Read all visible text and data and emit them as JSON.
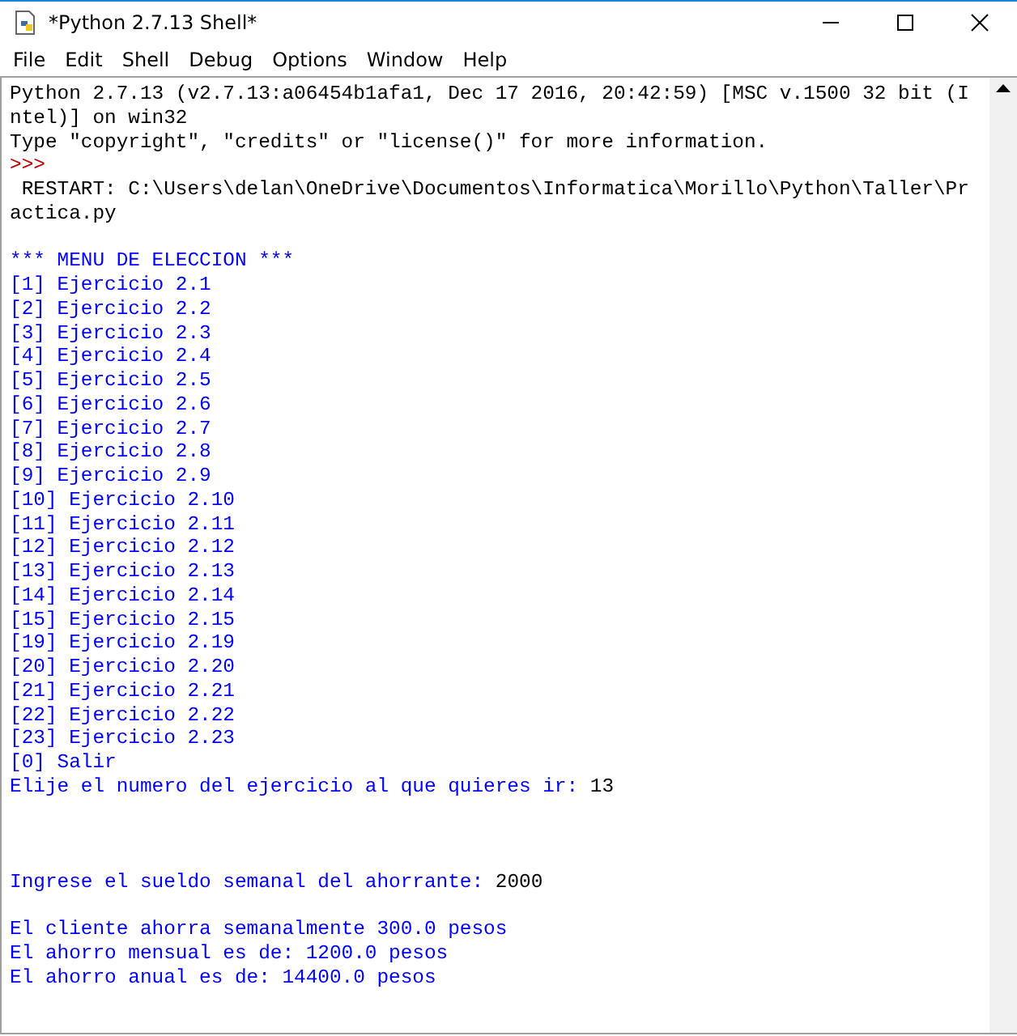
{
  "window": {
    "title": "*Python 2.7.13 Shell*"
  },
  "menu": [
    "File",
    "Edit",
    "Shell",
    "Debug",
    "Options",
    "Window",
    "Help"
  ],
  "shell": {
    "lines": [
      {
        "kind": "text",
        "segments": [
          {
            "kind": "output",
            "text": "Python 2.7.13 (v2.7.13:a06454b1afa1, Dec 17 2016, 20:42:59) [MSC v.1500 32 bit (I"
          }
        ]
      },
      {
        "kind": "text",
        "segments": [
          {
            "kind": "output",
            "text": "ntel)] on win32"
          }
        ]
      },
      {
        "kind": "text",
        "segments": [
          {
            "kind": "output",
            "text": "Type \"copyright\", \"credits\" or \"license()\" for more information."
          }
        ]
      },
      {
        "kind": "text",
        "segments": [
          {
            "kind": "prompt",
            "text": ">>>"
          }
        ]
      },
      {
        "kind": "text",
        "segments": [
          {
            "kind": "output",
            "text": " RESTART: C:\\Users\\delan\\OneDrive\\Documentos\\Informatica\\Morillo\\Python\\Taller\\Pr"
          }
        ]
      },
      {
        "kind": "text",
        "segments": [
          {
            "kind": "output",
            "text": "actica.py"
          }
        ]
      },
      {
        "kind": "blank"
      },
      {
        "kind": "text",
        "segments": [
          {
            "kind": "stdout",
            "text": "*** MENU DE ELECCION ***"
          }
        ]
      },
      {
        "kind": "text",
        "segments": [
          {
            "kind": "stdout",
            "text": "[1] Ejercicio 2.1"
          }
        ]
      },
      {
        "kind": "text",
        "segments": [
          {
            "kind": "stdout",
            "text": "[2] Ejercicio 2.2"
          }
        ]
      },
      {
        "kind": "text",
        "segments": [
          {
            "kind": "stdout",
            "text": "[3] Ejercicio 2.3"
          }
        ]
      },
      {
        "kind": "text",
        "segments": [
          {
            "kind": "stdout",
            "text": "[4] Ejercicio 2.4"
          }
        ]
      },
      {
        "kind": "text",
        "segments": [
          {
            "kind": "stdout",
            "text": "[5] Ejercicio 2.5"
          }
        ]
      },
      {
        "kind": "text",
        "segments": [
          {
            "kind": "stdout",
            "text": "[6] Ejercicio 2.6"
          }
        ]
      },
      {
        "kind": "text",
        "segments": [
          {
            "kind": "stdout",
            "text": "[7] Ejercicio 2.7"
          }
        ]
      },
      {
        "kind": "text",
        "segments": [
          {
            "kind": "stdout",
            "text": "[8] Ejercicio 2.8"
          }
        ]
      },
      {
        "kind": "text",
        "segments": [
          {
            "kind": "stdout",
            "text": "[9] Ejercicio 2.9"
          }
        ]
      },
      {
        "kind": "text",
        "segments": [
          {
            "kind": "stdout",
            "text": "[10] Ejercicio 2.10"
          }
        ]
      },
      {
        "kind": "text",
        "segments": [
          {
            "kind": "stdout",
            "text": "[11] Ejercicio 2.11"
          }
        ]
      },
      {
        "kind": "text",
        "segments": [
          {
            "kind": "stdout",
            "text": "[12] Ejercicio 2.12"
          }
        ]
      },
      {
        "kind": "text",
        "segments": [
          {
            "kind": "stdout",
            "text": "[13] Ejercicio 2.13"
          }
        ]
      },
      {
        "kind": "text",
        "segments": [
          {
            "kind": "stdout",
            "text": "[14] Ejercicio 2.14"
          }
        ]
      },
      {
        "kind": "text",
        "segments": [
          {
            "kind": "stdout",
            "text": "[15] Ejercicio 2.15"
          }
        ]
      },
      {
        "kind": "text",
        "segments": [
          {
            "kind": "stdout",
            "text": "[19] Ejercicio 2.19"
          }
        ]
      },
      {
        "kind": "text",
        "segments": [
          {
            "kind": "stdout",
            "text": "[20] Ejercicio 2.20"
          }
        ]
      },
      {
        "kind": "text",
        "segments": [
          {
            "kind": "stdout",
            "text": "[21] Ejercicio 2.21"
          }
        ]
      },
      {
        "kind": "text",
        "segments": [
          {
            "kind": "stdout",
            "text": "[22] Ejercicio 2.22"
          }
        ]
      },
      {
        "kind": "text",
        "segments": [
          {
            "kind": "stdout",
            "text": "[23] Ejercicio 2.23"
          }
        ]
      },
      {
        "kind": "text",
        "segments": [
          {
            "kind": "stdout",
            "text": "[0] Salir"
          }
        ]
      },
      {
        "kind": "text",
        "segments": [
          {
            "kind": "stdout",
            "text": "Elije el numero del ejercicio al que quieres ir: "
          },
          {
            "kind": "input",
            "text": "13"
          }
        ]
      },
      {
        "kind": "blank"
      },
      {
        "kind": "blank"
      },
      {
        "kind": "blank"
      },
      {
        "kind": "text",
        "segments": [
          {
            "kind": "stdout",
            "text": "Ingrese el sueldo semanal del ahorrante: "
          },
          {
            "kind": "input",
            "text": "2000"
          }
        ]
      },
      {
        "kind": "blank"
      },
      {
        "kind": "text",
        "segments": [
          {
            "kind": "stdout",
            "text": "El cliente ahorra semanalmente 300.0 pesos"
          }
        ]
      },
      {
        "kind": "text",
        "segments": [
          {
            "kind": "stdout",
            "text": "El ahorro mensual es de: 1200.0 pesos"
          }
        ]
      },
      {
        "kind": "text",
        "segments": [
          {
            "kind": "stdout",
            "text": "El ahorro anual es de: 14400.0 pesos"
          }
        ]
      }
    ]
  }
}
